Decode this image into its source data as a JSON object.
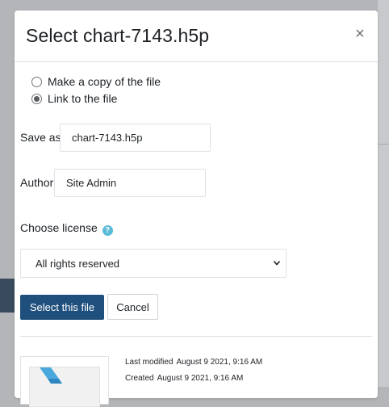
{
  "dialog": {
    "title": "Select chart-7143.h5p",
    "close_label": "×"
  },
  "options": [
    {
      "label": "Make a copy of the file",
      "checked": false
    },
    {
      "label": "Link to the file",
      "checked": true
    }
  ],
  "save_as": {
    "label": "Save as",
    "value": "chart-7143.h5p"
  },
  "author": {
    "label": "Author",
    "value": "Site Admin"
  },
  "license": {
    "label": "Choose license",
    "help_icon": "question-circle-icon",
    "selected": "All rights reserved"
  },
  "buttons": {
    "select_label": "Select this file",
    "cancel_label": "Cancel"
  },
  "file_info": {
    "last_modified_label": "Last modified",
    "last_modified_value": "August 9 2021, 9:16 AM",
    "created_label": "Created",
    "created_value": "August 9 2021, 9:16 AM"
  },
  "colors": {
    "primary_button": "#1f4f7d",
    "help_icon": "#5bb9d8",
    "thumbnail_accent": "#4aa7dc"
  }
}
